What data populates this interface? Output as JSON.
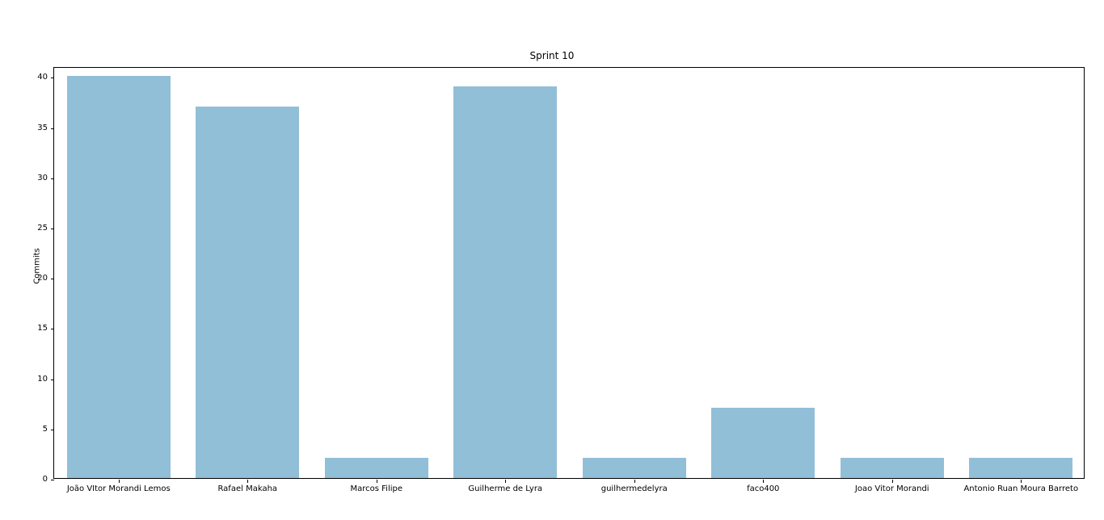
{
  "chart_data": {
    "type": "bar",
    "title": "Sprint 10",
    "xlabel": "",
    "ylabel": "Commits",
    "ylim": [
      0,
      41
    ],
    "yticks": [
      0,
      5,
      10,
      15,
      20,
      25,
      30,
      35,
      40
    ],
    "categories": [
      "João VItor Morandi Lemos",
      "Rafael Makaha",
      "Marcos Filipe",
      "Guilherme de Lyra",
      "guilhermedelyra",
      "faco400",
      "Joao Vitor Morandi",
      "Antonio Ruan Moura Barreto"
    ],
    "values": [
      40,
      37,
      2,
      39,
      2,
      7,
      2,
      2
    ]
  },
  "layout": {
    "figure_w": 1366,
    "figure_h": 644,
    "axes_left": 66,
    "axes_top": 83,
    "axes_width": 1276,
    "axes_height": 510,
    "title_top": 62,
    "ylabel_top": 324,
    "bar_color": "#92bfd8",
    "bar_rel_width": 0.8
  }
}
